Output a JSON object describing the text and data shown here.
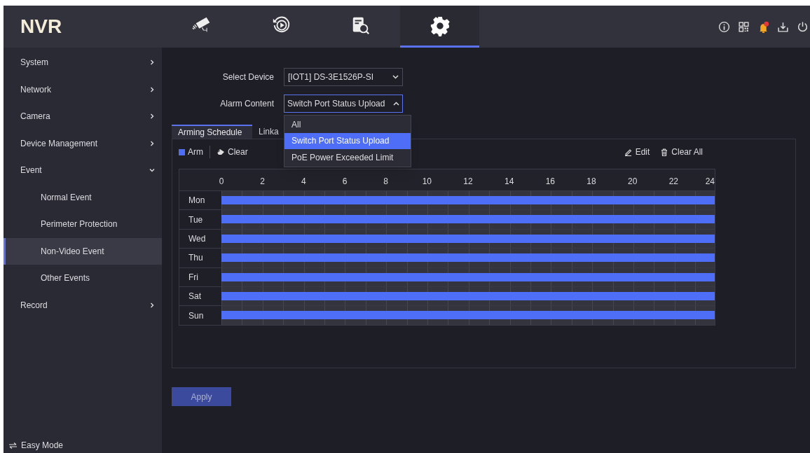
{
  "app": {
    "logo": "NVR"
  },
  "top_tabs": [
    {
      "kind": "live",
      "selected": false
    },
    {
      "kind": "playback",
      "selected": false
    },
    {
      "kind": "search",
      "selected": false
    },
    {
      "kind": "settings",
      "selected": true
    }
  ],
  "header_icons": [
    {
      "kind": "info"
    },
    {
      "kind": "qr"
    },
    {
      "kind": "bell"
    },
    {
      "kind": "download"
    },
    {
      "kind": "power"
    }
  ],
  "sidebar": {
    "items": [
      {
        "label": "System",
        "expanded": false,
        "selected": false
      },
      {
        "label": "Network",
        "expanded": false,
        "selected": false
      },
      {
        "label": "Camera",
        "expanded": false,
        "selected": false
      },
      {
        "label": "Device Management",
        "expanded": false,
        "selected": false
      },
      {
        "label": "Event",
        "expanded": true,
        "selected": false,
        "children": [
          {
            "label": "Normal Event",
            "selected": false
          },
          {
            "label": "Perimeter Protection",
            "selected": false
          },
          {
            "label": "Non-Video Event",
            "selected": true
          },
          {
            "label": "Other Events",
            "selected": false
          }
        ]
      },
      {
        "label": "Record",
        "expanded": false,
        "selected": false
      }
    ],
    "footer": "Easy Mode"
  },
  "form": {
    "select_device": {
      "label": "Select Device",
      "value": "[IOT1] DS-3E1526P-SI"
    },
    "alarm_content": {
      "label": "Alarm Content",
      "value": "Switch Port Status Upload",
      "expanded": true,
      "options": [
        {
          "label": "All",
          "selected": false
        },
        {
          "label": "Switch Port Status Upload",
          "selected": true
        },
        {
          "label": "PoE Power Exceeded Limit",
          "selected": false
        }
      ]
    }
  },
  "schedule": {
    "tabs": [
      {
        "label": "Arming Schedule",
        "selected": true
      },
      {
        "label": "Linka",
        "selected": false
      }
    ],
    "tools": [
      {
        "kind": "arm",
        "label": "Arm"
      },
      {
        "kind": "clear",
        "label": "Clear"
      }
    ],
    "actions": [
      {
        "kind": "edit",
        "label": "Edit"
      },
      {
        "kind": "clear_all",
        "label": "Clear All"
      }
    ],
    "hours": [
      "0",
      "2",
      "4",
      "6",
      "8",
      "10",
      "12",
      "14",
      "16",
      "18",
      "20",
      "22",
      "24"
    ],
    "days": [
      {
        "label": "Mon",
        "level": 1
      },
      {
        "label": "Tue",
        "level": 1
      },
      {
        "label": "Wed",
        "level": 1
      },
      {
        "label": "Thu",
        "level": 1
      },
      {
        "label": "Fri",
        "level": 1
      },
      {
        "label": "Sat",
        "level": 1
      },
      {
        "label": "Sun",
        "level": 1
      }
    ]
  },
  "apply_button": "Apply"
}
